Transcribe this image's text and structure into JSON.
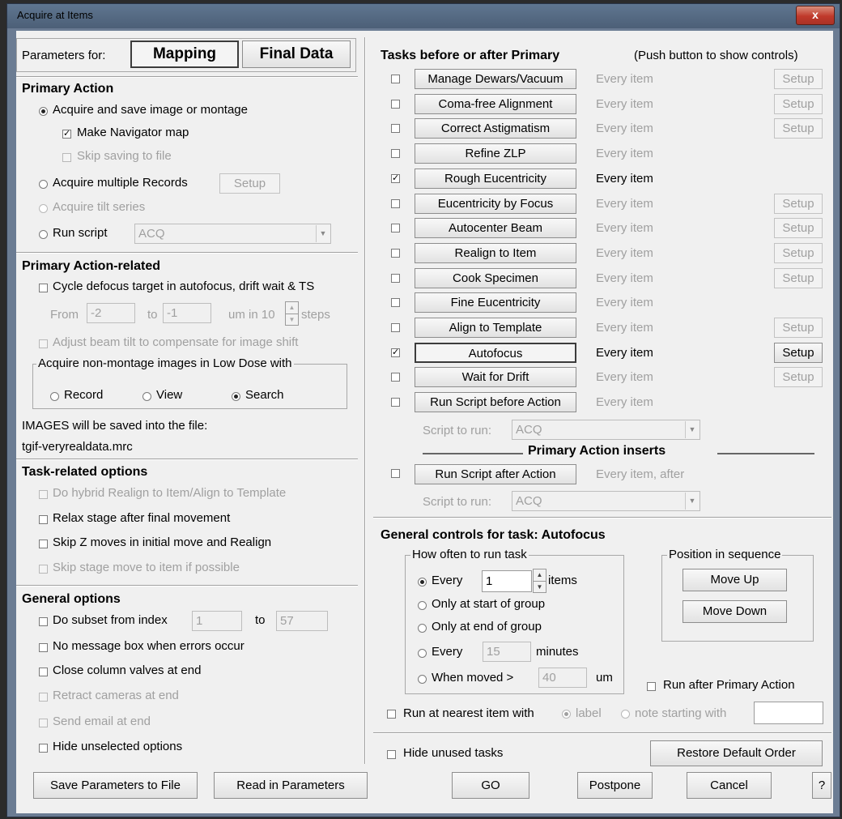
{
  "window": {
    "title": "Acquire at Items",
    "close_glyph": "x"
  },
  "params_for": {
    "label": "Parameters for:",
    "mapping": "Mapping",
    "final_data": "Final Data"
  },
  "primary_action": {
    "header": "Primary Action",
    "acquire_save": "Acquire and save image or montage",
    "make_nav_map": "Make Navigator map",
    "skip_saving": "Skip saving to file",
    "acquire_multiple": "Acquire multiple Records",
    "setup": "Setup",
    "acquire_tilt": "Acquire tilt series",
    "run_script": "Run script",
    "script_value": "ACQ"
  },
  "primary_related": {
    "header": "Primary Action-related",
    "cycle_defocus": "Cycle defocus target in autofocus, drift wait & TS",
    "from": "From",
    "from_value": "-2",
    "to": "to",
    "to_value": "-1",
    "um_in": "um in 10",
    "steps": "steps",
    "adjust_tilt": "Adjust beam tilt to compensate for image shift",
    "low_dose_legend": "Acquire non-montage images in Low Dose with",
    "record": "Record",
    "view": "View",
    "search": "Search",
    "images_saved": "IMAGES will be saved into the file:",
    "filename": "tgif-veryrealdata.mrc"
  },
  "task_related": {
    "header": "Task-related options",
    "hybrid": "Do hybrid Realign to Item/Align to Template",
    "relax": "Relax stage after final movement",
    "skip_z": "Skip Z moves in initial move and Realign",
    "skip_stage": "Skip stage move to item if possible"
  },
  "general_options": {
    "header": "General options",
    "subset": "Do subset from index",
    "subset_from": "1",
    "subset_to_label": "to",
    "subset_to": "57",
    "no_message": "No message box when errors occur",
    "close_valves": "Close column valves at end",
    "retract": "Retract cameras at end",
    "send_email": "Send email at end",
    "hide_unselected": "Hide unselected options"
  },
  "tasks": {
    "header": "Tasks before or after Primary",
    "hint": "(Push button to show controls)",
    "items": [
      {
        "label": "Manage Dewars/Vacuum",
        "every": "Every item",
        "checked": false,
        "setup": true,
        "active": false
      },
      {
        "label": "Coma-free Alignment",
        "every": "Every item",
        "checked": false,
        "setup": true,
        "active": false
      },
      {
        "label": "Correct Astigmatism",
        "every": "Every item",
        "checked": false,
        "setup": true,
        "active": false
      },
      {
        "label": "Refine ZLP",
        "every": "Every item",
        "checked": false,
        "setup": false,
        "active": false
      },
      {
        "label": "Rough Eucentricity",
        "every": "Every item",
        "checked": true,
        "setup": false,
        "active": false
      },
      {
        "label": "Eucentricity by Focus",
        "every": "Every item",
        "checked": false,
        "setup": true,
        "active": false
      },
      {
        "label": "Autocenter Beam",
        "every": "Every item",
        "checked": false,
        "setup": true,
        "active": false
      },
      {
        "label": "Realign to Item",
        "every": "Every item",
        "checked": false,
        "setup": true,
        "active": false
      },
      {
        "label": "Cook Specimen",
        "every": "Every item",
        "checked": false,
        "setup": true,
        "active": false
      },
      {
        "label": "Fine Eucentricity",
        "every": "Every item",
        "checked": false,
        "setup": false,
        "active": false
      },
      {
        "label": "Align to Template",
        "every": "Every item",
        "checked": false,
        "setup": true,
        "active": false
      },
      {
        "label": "Autofocus",
        "every": "Every item",
        "checked": true,
        "setup": true,
        "active": true
      },
      {
        "label": "Wait for Drift",
        "every": "Every item",
        "checked": false,
        "setup": true,
        "active": false
      },
      {
        "label": "Run Script before Action",
        "every": "Every item",
        "checked": false,
        "setup": false,
        "active": false
      }
    ],
    "setup": "Setup",
    "script_to_run": "Script to run:",
    "script_value": "ACQ",
    "primary_inserts": "Primary Action inserts",
    "after_label": "Run Script after Action",
    "after_every": "Every item, after",
    "script_to_run_2": "Script to run:",
    "script_value_2": "ACQ"
  },
  "general_controls": {
    "header": "General controls for task: Autofocus",
    "how_often_legend": "How often to run task",
    "every": "Every",
    "every_value": "1",
    "items": "items",
    "only_start": "Only at start of group",
    "only_end": "Only at end of group",
    "every_min": "Every",
    "minutes_value": "15",
    "minutes": "minutes",
    "when_moved": "When moved >",
    "moved_value": "40",
    "um": "um",
    "position_legend": "Position in sequence",
    "move_up": "Move Up",
    "move_down": "Move Down",
    "run_after": "Run after Primary Action",
    "run_nearest": "Run at nearest item with",
    "label": "label",
    "note_starting": "note starting with",
    "note_value": ""
  },
  "bottom": {
    "hide_unused": "Hide unused tasks",
    "restore": "Restore Default Order",
    "save_params": "Save Parameters to File",
    "read_params": "Read in Parameters",
    "go": "GO",
    "postpone": "Postpone",
    "cancel": "Cancel",
    "help": "?"
  },
  "colors": {
    "titlebar": "#5f7690",
    "close_button": "#c0392b",
    "dialog_bg": "#f0f0f0",
    "disabled_text": "#a0a0a0"
  }
}
